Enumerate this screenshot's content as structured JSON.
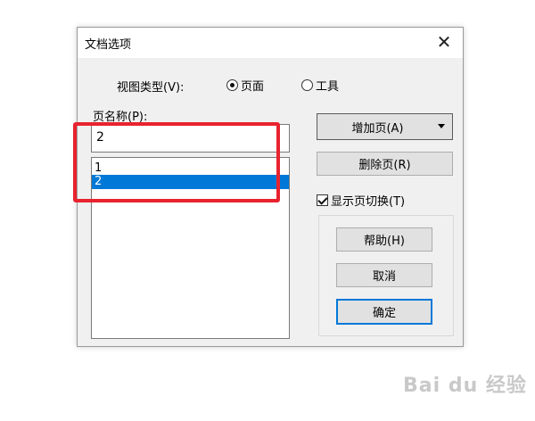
{
  "dialog": {
    "title": "文档选项",
    "close_glyph": "✕"
  },
  "view_type": {
    "label": "视图类型(V):",
    "options": [
      {
        "label": "页面",
        "selected": true
      },
      {
        "label": "工具",
        "selected": false
      }
    ]
  },
  "page_name": {
    "label": "页名称(P):",
    "value": "2"
  },
  "page_list": {
    "items": [
      "1",
      "2"
    ],
    "selected_index": 1
  },
  "buttons": {
    "add_page": "增加页(A)",
    "delete_page": "删除页(R)",
    "help": "帮助(H)",
    "cancel": "取消",
    "ok": "确定"
  },
  "show_page_switch": {
    "label": "显示页切换(T)",
    "checked": true
  },
  "watermark": {
    "text": "Bai du 经验"
  },
  "colors": {
    "selection": "#0078d7",
    "highlight_box": "#e8232f"
  }
}
